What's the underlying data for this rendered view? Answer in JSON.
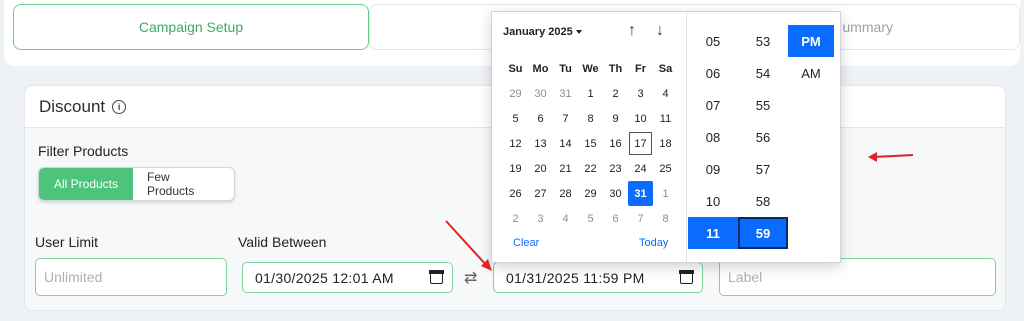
{
  "steps": {
    "active": "Campaign Setup",
    "summary": "ummary"
  },
  "discount": {
    "title": "Discount",
    "info_icon": "info-icon"
  },
  "filter": {
    "label": "Filter Products",
    "options": [
      "All Products",
      "Few Products"
    ],
    "selected": "All Products"
  },
  "user_limit": {
    "label": "User Limit",
    "placeholder": "Unlimited"
  },
  "valid_between": {
    "label": "Valid Between",
    "start": "01/30/2025 12:01 AM",
    "end": "01/31/2025 11:59 PM",
    "swap_icon": "swap-arrows-icon"
  },
  "label_field": {
    "placeholder": "Label"
  },
  "calendar": {
    "month": "January 2025",
    "weekdays": [
      "Su",
      "Mo",
      "Tu",
      "We",
      "Th",
      "Fr",
      "Sa"
    ],
    "days": [
      [
        "29",
        "30",
        "31",
        "1",
        "2",
        "3",
        "4"
      ],
      [
        "5",
        "6",
        "7",
        "8",
        "9",
        "10",
        "11"
      ],
      [
        "12",
        "13",
        "14",
        "15",
        "16",
        "17",
        "18"
      ],
      [
        "19",
        "20",
        "21",
        "22",
        "23",
        "24",
        "25"
      ],
      [
        "26",
        "27",
        "28",
        "29",
        "30",
        "31",
        "1"
      ],
      [
        "2",
        "3",
        "4",
        "5",
        "6",
        "7",
        "8"
      ]
    ],
    "today": "17",
    "selected": "31",
    "clear": "Clear",
    "today_label": "Today",
    "hours": [
      "05",
      "06",
      "07",
      "08",
      "09",
      "10",
      "11"
    ],
    "minutes": [
      "53",
      "54",
      "55",
      "56",
      "57",
      "58",
      "59"
    ],
    "ampm": [
      "PM",
      "AM"
    ],
    "selected_hour": "11",
    "selected_minute": "59",
    "selected_ampm": "PM"
  },
  "colors": {
    "accent_green": "#4cc47b",
    "picker_blue": "#0a6cff",
    "annotation_red": "#e02424"
  }
}
